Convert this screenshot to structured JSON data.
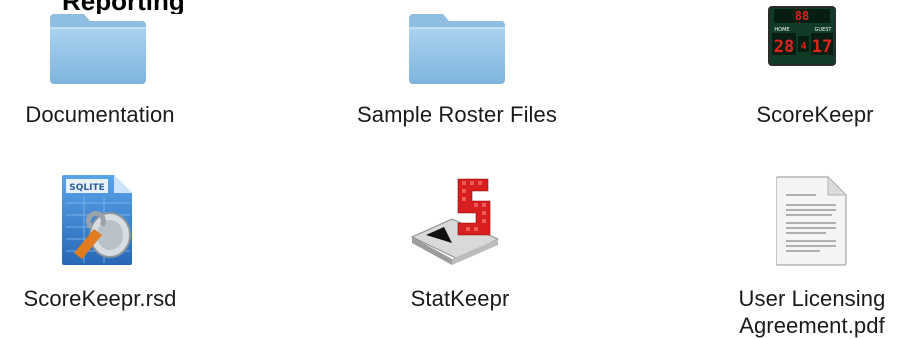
{
  "window": {
    "partial_title": "Reporting"
  },
  "items": [
    {
      "label": "Documentation",
      "icon": "folder-icon"
    },
    {
      "label": "Sample Roster Files",
      "icon": "folder-icon"
    },
    {
      "label": "ScoreKeepr",
      "icon": "scoreboard-app-icon",
      "scoreboard": {
        "home_label": "HOME",
        "guest_label": "GUEST",
        "home_score": "28",
        "guest_score": "17",
        "period": "4",
        "top_digits": "88"
      }
    },
    {
      "label": "ScoreKeepr.rsd",
      "icon": "sqlite-database-icon",
      "badge": "SQLITE"
    },
    {
      "label": "StatKeepr",
      "icon": "statkeepr-app-icon"
    },
    {
      "label_line1": "User Licensing",
      "label_line2": "Agreement.pdf",
      "icon": "pdf-document-icon"
    }
  ],
  "colors": {
    "folder": "#8fc3e6",
    "scoreboard_red": "#e2231a",
    "statkeepr_red": "#d81e1e",
    "sqlite_blue": "#2f7fd1"
  }
}
